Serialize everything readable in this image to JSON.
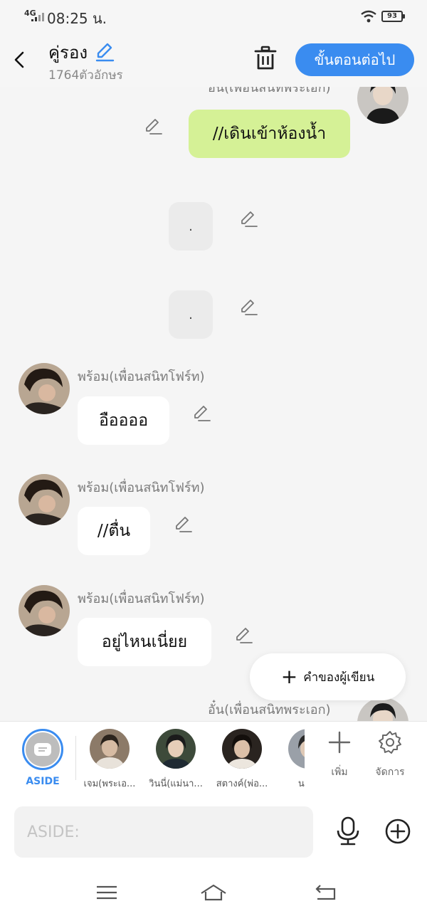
{
  "status_bar": {
    "network": "4G",
    "time": "08:25 น.",
    "battery": "93"
  },
  "header": {
    "title": "คู่รอง",
    "char_count": "1764ตัวอักษร",
    "next_label": "ขั้นตอนต่อไป"
  },
  "chat": {
    "top_partial_name": "อั๋น(เพื่อนสนิทพระเอก)",
    "messages": [
      {
        "sender": "",
        "text": "//เดินเข้าห้องน้ำ"
      },
      {
        "sender": "",
        "text": "."
      },
      {
        "sender": "",
        "text": "."
      },
      {
        "sender": "พร้อม(เพื่อนสนิทโฟร์ท)",
        "text": "อืออออ"
      },
      {
        "sender": "พร้อม(เพื่อนสนิทโฟร์ท)",
        "text": "//ตื่น"
      },
      {
        "sender": "พร้อม(เพื่อนสนิทโฟร์ท)",
        "text": "อยู่ไหนเนี่ยย"
      }
    ],
    "bottom_name": "อั๋น(เพื่อนสนิทพระเอก)"
  },
  "fab": {
    "label": "คำของผู้เขียน"
  },
  "characters": {
    "aside_label": "ASIDE",
    "items": [
      {
        "label": "เจม(พระเอ..."
      },
      {
        "label": "วินนี่(แม่นา..."
      },
      {
        "label": "สตางค์(พ่อ..."
      },
      {
        "label": "นายเ"
      }
    ],
    "add_label": "เพิ่ม",
    "manage_label": "จัดการ"
  },
  "input": {
    "placeholder": "ASIDE:"
  },
  "colors": {
    "accent": "#3a8cf0",
    "my_bubble": "#d5f196",
    "background": "#f5f5f5"
  },
  "icons": [
    "back-icon",
    "pencil-icon",
    "trash-icon",
    "plus-icon",
    "gear-icon",
    "microphone-icon",
    "add-circle-icon",
    "menu-icon",
    "home-icon",
    "return-icon"
  ]
}
